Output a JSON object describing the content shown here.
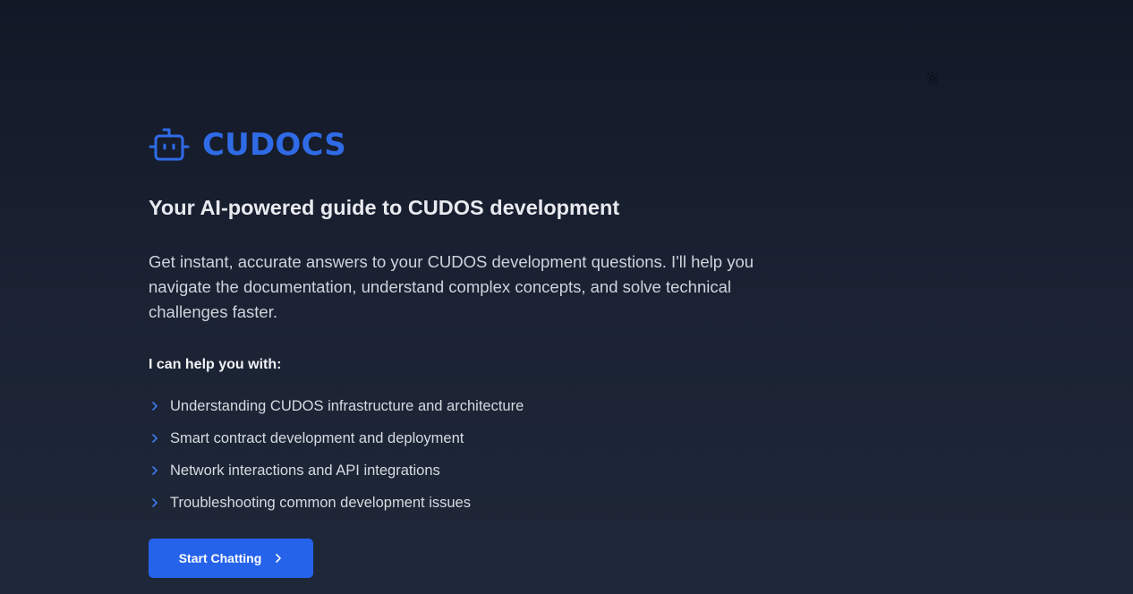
{
  "header": {
    "theme_toggle_icon": "sun-icon"
  },
  "brand": {
    "icon": "robot-icon",
    "name": "CUDOCS",
    "color": "#2f6be6"
  },
  "hero": {
    "tagline": "Your AI-powered guide to CUDOS development",
    "description": "Get instant, accurate answers to your CUDOS development questions. I'll help you navigate the documentation, understand complex concepts, and solve technical challenges faster."
  },
  "help": {
    "heading": "I can help you with:",
    "bullet_icon": "chevron-right-icon",
    "items": [
      "Understanding CUDOS infrastructure and architecture",
      "Smart contract development and deployment",
      "Network interactions and API integrations",
      "Troubleshooting common development issues"
    ]
  },
  "cta": {
    "label": "Start Chatting",
    "icon": "chevron-right-icon",
    "color": "#2563eb"
  }
}
